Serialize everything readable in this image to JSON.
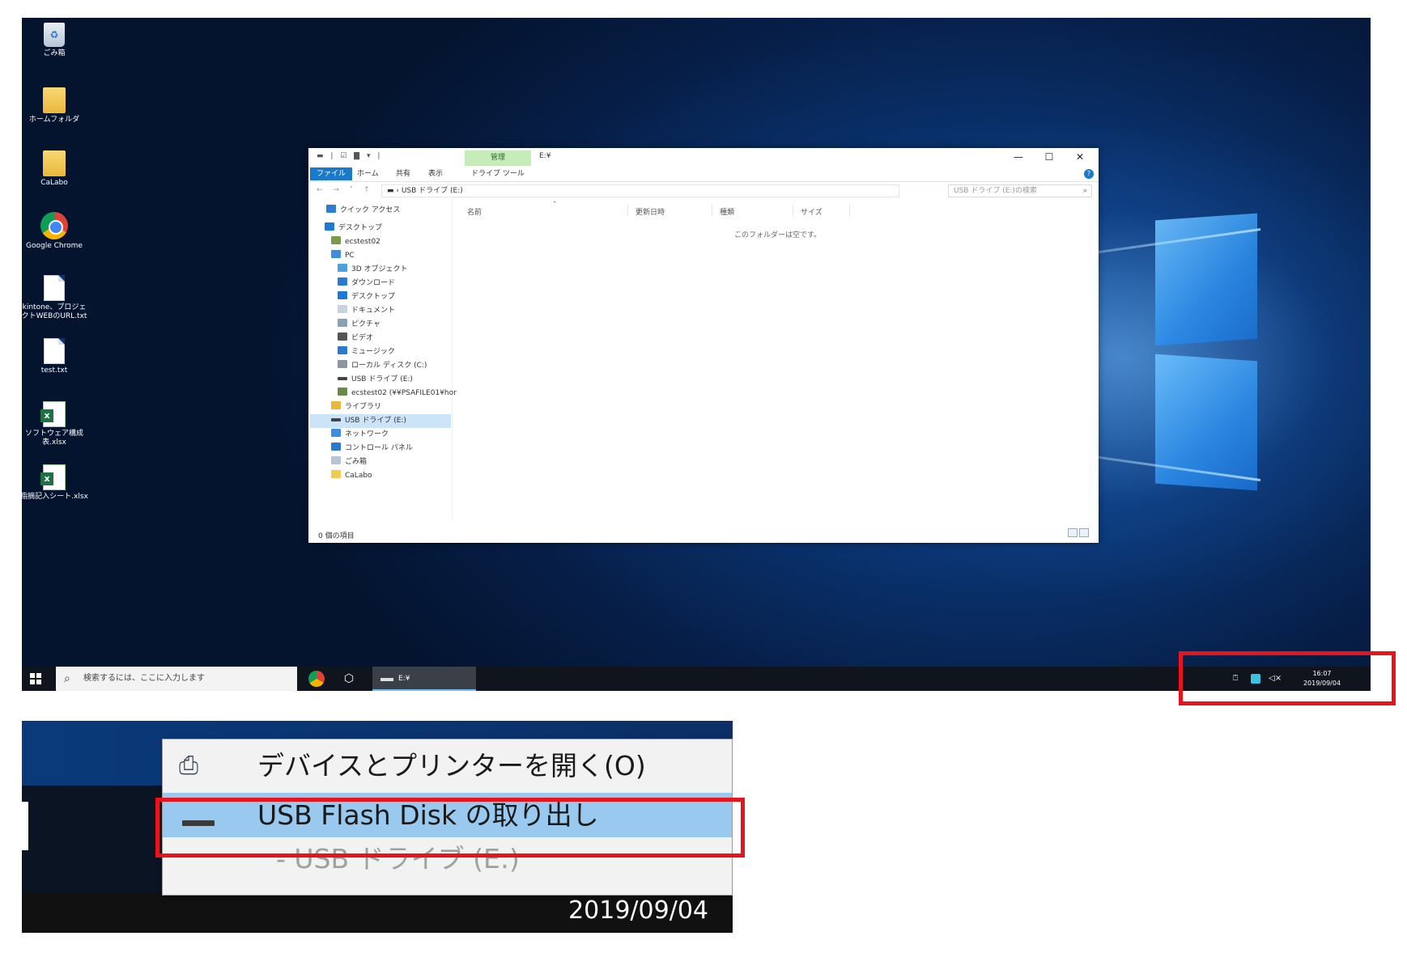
{
  "desktop": {
    "icons": [
      {
        "label": "ごみ箱",
        "type": "bin-icon"
      },
      {
        "label": "ホームフォルダ",
        "type": "folder-icon"
      },
      {
        "label": "CaLabo",
        "type": "folder-icon"
      },
      {
        "label": "Google Chrome",
        "type": "chrome-icon"
      },
      {
        "label": "kintone、プロジェクトWEBのURL.txt",
        "type": "text-file-icon"
      },
      {
        "label": "test.txt",
        "type": "text-file-icon"
      },
      {
        "label": "ソフトウェア構成表.xlsx",
        "type": "excel-file-icon"
      },
      {
        "label": "指摘記入シート.xlsx",
        "type": "excel-file-icon"
      }
    ]
  },
  "explorer": {
    "title": "E:¥",
    "manage_tab": "管理",
    "ribbon_tabs": [
      "ファイル",
      "ホーム",
      "共有",
      "表示",
      "ドライブ ツール"
    ],
    "address": "▬ › USB ドライブ (E:)",
    "search_placeholder": "USB ドライブ (E:)の検索",
    "nav_items": [
      "クイック アクセス",
      "デスクトップ",
      "ecstest02",
      "PC",
      "3D オブジェクト",
      "ダウンロード",
      "デスクトップ",
      "ドキュメント",
      "ピクチャ",
      "ビデオ",
      "ミュージック",
      "ローカル ディスク (C:)",
      "USB ドライブ (E:)",
      "ecstest02 (¥¥PSAFILE01¥hor",
      "ライブラリ",
      "USB ドライブ (E:)",
      "ネットワーク",
      "コントロール パネル",
      "ごみ箱",
      "CaLabo"
    ],
    "columns": [
      "名前",
      "更新日時",
      "種類",
      "サイズ"
    ],
    "empty_message": "このフォルダーは空です。",
    "status": "0 個の項目"
  },
  "taskbar": {
    "search_placeholder": "検索するには、ここに入力します",
    "active_app": "E:¥",
    "time": "16:07",
    "date": "2019/09/04"
  },
  "zoom_menu": {
    "items": [
      {
        "label": "デバイスとプリンターを開く(O)",
        "icon": "devices-printers-icon"
      },
      {
        "label": "USB Flash Disk の取り出し",
        "icon": "usb-drive-icon"
      },
      {
        "label": "- USB ドライブ (E:)",
        "icon": ""
      }
    ],
    "date": "2019/09/04"
  },
  "colors": {
    "highlight": "#e8141c",
    "accent": "#1979ca",
    "menu_hover": "#99c9ef"
  }
}
